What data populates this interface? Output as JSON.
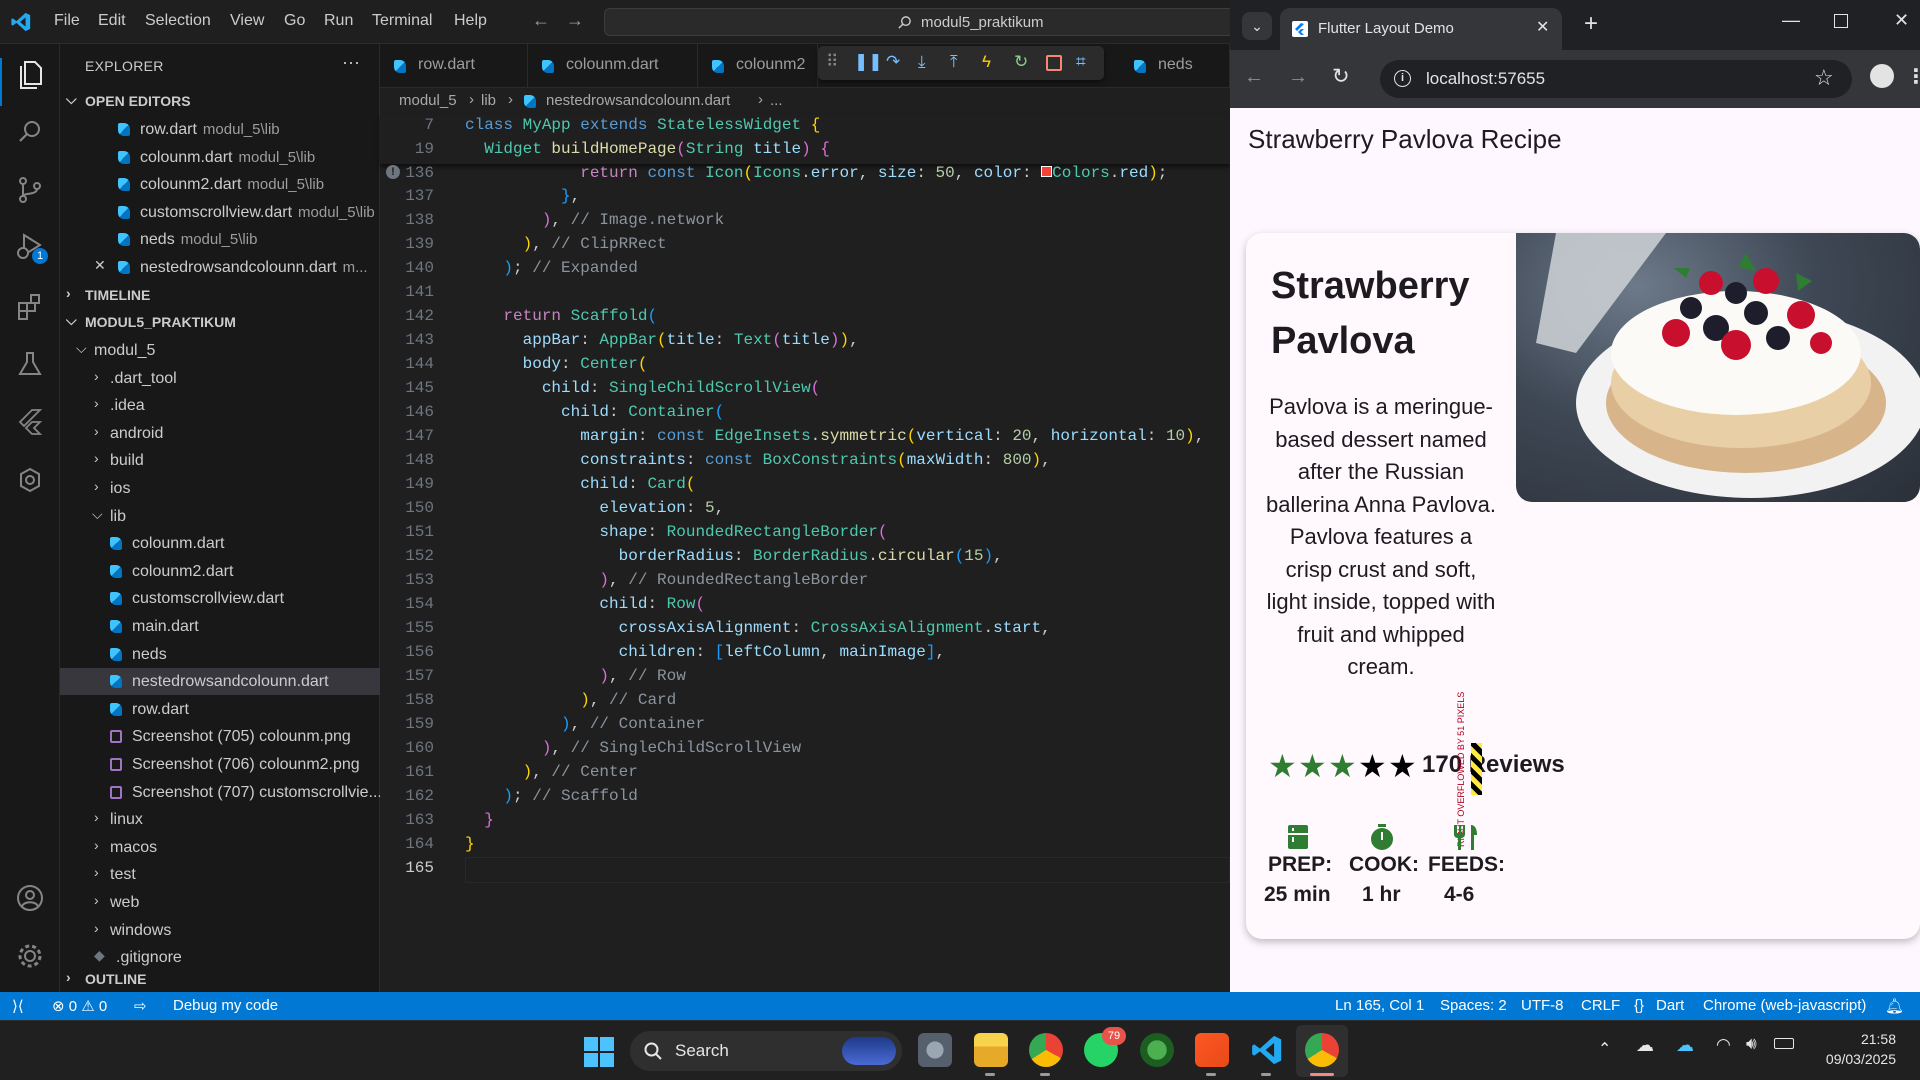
{
  "vscode": {
    "menu": [
      "File",
      "Edit",
      "Selection",
      "View",
      "Go",
      "Run",
      "Terminal",
      "Help"
    ],
    "search_text": "modul5_praktikum",
    "explorer_title": "EXPLORER",
    "open_editors_title": "OPEN EDITORS",
    "open_editors": [
      {
        "name": "row.dart",
        "path": "modul_5\\lib"
      },
      {
        "name": "colounm.dart",
        "path": "modul_5\\lib"
      },
      {
        "name": "colounm2.dart",
        "path": "modul_5\\lib"
      },
      {
        "name": "customscrollview.dart",
        "path": "modul_5\\lib"
      },
      {
        "name": "neds",
        "path": "modul_5\\lib"
      },
      {
        "name": "nestedrowsandcolounn.dart",
        "path": "m..."
      }
    ],
    "timeline_title": "TIMELINE",
    "project_title": "MODUL5_PRAKTIKUM",
    "tree": [
      {
        "name": "modul_5",
        "kind": "folder-open",
        "depth": 1
      },
      {
        "name": ".dart_tool",
        "kind": "folder",
        "depth": 2
      },
      {
        "name": ".idea",
        "kind": "folder",
        "depth": 2
      },
      {
        "name": "android",
        "kind": "folder",
        "depth": 2
      },
      {
        "name": "build",
        "kind": "folder",
        "depth": 2
      },
      {
        "name": "ios",
        "kind": "folder",
        "depth": 2
      },
      {
        "name": "lib",
        "kind": "folder-open",
        "depth": 2
      },
      {
        "name": "colounm.dart",
        "kind": "dart",
        "depth": 3
      },
      {
        "name": "colounm2.dart",
        "kind": "dart",
        "depth": 3
      },
      {
        "name": "customscrollview.dart",
        "kind": "dart",
        "depth": 3
      },
      {
        "name": "main.dart",
        "kind": "dart",
        "depth": 3
      },
      {
        "name": "neds",
        "kind": "dart",
        "depth": 3
      },
      {
        "name": "nestedrowsandcolounn.dart",
        "kind": "dart",
        "depth": 3
      },
      {
        "name": "row.dart",
        "kind": "dart",
        "depth": 3
      },
      {
        "name": "Screenshot (705) colounm.png",
        "kind": "png",
        "depth": 3
      },
      {
        "name": "Screenshot (706) colounm2.png",
        "kind": "png",
        "depth": 3
      },
      {
        "name": "Screenshot (707) customscrollvie...",
        "kind": "png",
        "depth": 3
      },
      {
        "name": "linux",
        "kind": "folder",
        "depth": 2
      },
      {
        "name": "macos",
        "kind": "folder",
        "depth": 2
      },
      {
        "name": "test",
        "kind": "folder",
        "depth": 2
      },
      {
        "name": "web",
        "kind": "folder",
        "depth": 2
      },
      {
        "name": "windows",
        "kind": "folder",
        "depth": 2
      },
      {
        "name": ".gitignore",
        "kind": "git",
        "depth": 2
      }
    ],
    "outline_title": "OUTLINE",
    "tabs": [
      "row.dart",
      "colounm.dart",
      "colounm2",
      "neds"
    ],
    "breadcrumb": [
      "modul_5",
      "lib",
      "nestedrowsandcolounn.dart",
      "..."
    ],
    "debug_badge": "1",
    "line_numbers": [
      "7",
      "19",
      "136",
      "137",
      "138",
      "139",
      "140",
      "141",
      "142",
      "143",
      "144",
      "145",
      "146",
      "147",
      "148",
      "149",
      "150",
      "151",
      "152",
      "153",
      "154",
      "155",
      "156",
      "157",
      "158",
      "159",
      "160",
      "161",
      "162",
      "163",
      "164",
      "165"
    ],
    "status": {
      "errors": "0",
      "warnings": "0",
      "debug": "Debug my code",
      "position": "Ln 165, Col 1",
      "spaces": "Spaces: 2",
      "encoding": "UTF-8",
      "eol": "CRLF",
      "language": "Dart",
      "device": "Chrome (web-javascript)"
    }
  },
  "chrome": {
    "tab_title": "Flutter Layout Demo",
    "url": "localhost:57655",
    "app_title": "Strawberry Pavlova Recipe",
    "card_title": "Strawberry Pavlova",
    "description": "Pavlova is a meringue-based dessert named after the Russian ballerina Anna Pavlova. Pavlova features a crisp crust and soft, light inside, topped with fruit and whipped cream.",
    "reviews": "170 Reviews",
    "overflow_text": "RIGHT OVERFLOWED BY 51 PIXELS",
    "stars": {
      "rating": 3,
      "max": 5
    },
    "info": [
      {
        "label": "PREP:",
        "value": "25 min",
        "icon": "kitchen-icon"
      },
      {
        "label": "COOK:",
        "value": "1 hr",
        "icon": "timer-icon"
      },
      {
        "label": "FEEDS:",
        "value": "4-6",
        "icon": "restaurant-icon"
      }
    ],
    "accent": "#2e7d32"
  },
  "taskbar": {
    "search_label": "Search",
    "time": "21:58",
    "date": "09/03/2025",
    "whatsapp_badge": "79"
  },
  "colors": {
    "statusbar": "#0078d4",
    "editor_bg": "#1f1f1f",
    "sidebar_bg": "#181818"
  }
}
